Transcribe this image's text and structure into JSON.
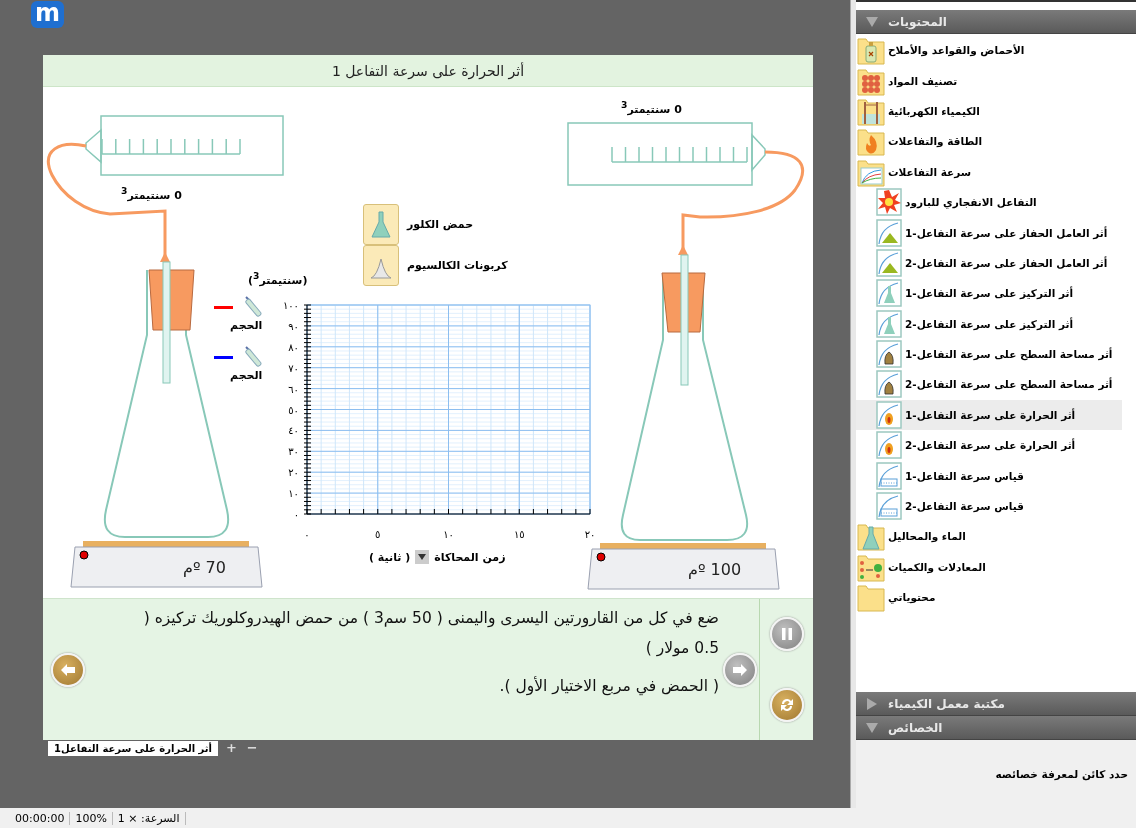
{
  "logo": "m",
  "simulation": {
    "title": "أثر الحرارة على سرعة  التفاعل 1",
    "left_setup": {
      "syringe_reading": "0 سنتيمتر$^{3}$",
      "temperature": "70 ºم"
    },
    "right_setup": {
      "syringe_reading": "0 سنتيمتر$^{3}$",
      "temperature": "100 ºم"
    },
    "reagents": [
      {
        "label": "حمض الكلور",
        "kind": "flask"
      },
      {
        "label": "كربونات الكالسيوم",
        "kind": "powder"
      }
    ],
    "legend": [
      {
        "label": "الحجم",
        "color": "#ff0000"
      },
      {
        "label": "الحجم",
        "color": "#0000ff"
      }
    ],
    "chart_data": {
      "type": "line",
      "grid": true,
      "xlabel": "زمن المحاكاة",
      "ylabel": "(سنتيمتر$^{3}$)",
      "xlim": [
        0,
        20
      ],
      "ylim": [
        0,
        100
      ],
      "xticks": [
        {
          "value": 0,
          "label": "٠"
        },
        {
          "value": 5,
          "label": "٥"
        },
        {
          "value": 10,
          "label": "١٠"
        },
        {
          "value": 15,
          "label": "١٥"
        },
        {
          "value": 20,
          "label": "٢٠"
        }
      ],
      "yticks": [
        {
          "value": 0,
          "label": "٠"
        },
        {
          "value": 10,
          "label": "١٠"
        },
        {
          "value": 20,
          "label": "٢٠"
        },
        {
          "value": 30,
          "label": "٣٠"
        },
        {
          "value": 40,
          "label": "٤٠"
        },
        {
          "value": 50,
          "label": "٥٠"
        },
        {
          "value": 60,
          "label": "٦٠"
        },
        {
          "value": 70,
          "label": "٧٠"
        },
        {
          "value": 80,
          "label": "٨٠"
        },
        {
          "value": 90,
          "label": "٩٠"
        },
        {
          "value": 100,
          "label": "١٠٠"
        }
      ]
    },
    "time_unit": "( ثانية )",
    "instructions": [
      "ضع في كل من القارورتين اليسرى واليمنى ( 50 سم3 ) من حمض الهيدروكلوريك تركيزه ( 0.5 مولار )",
      "( الحمض في مربع الاختيار الأول )."
    ]
  },
  "tabs": [
    {
      "label": "أثر الحرارة على سرعة التفاعل1",
      "selected": true
    }
  ],
  "tab_controls": [
    "−",
    "+"
  ],
  "status_bar": [
    "السرعة: × 1",
    "100%",
    "00:00:00"
  ],
  "sidebar": {
    "panels": [
      {
        "title": "المحتويات",
        "expanded": true,
        "tree": [
          {
            "label": "الأحماض والقواعد والأملاح",
            "kind": "bottle",
            "selected": false
          },
          {
            "label": "تصنيف المواد",
            "kind": "spheres",
            "selected": false
          },
          {
            "label": "الكيمياء الكهربائية",
            "kind": "cell",
            "selected": false
          },
          {
            "label": "الطاقة والتفاعلات",
            "kind": "flame",
            "selected": false
          },
          {
            "label": "سرعة التفاعلات",
            "kind": "curves",
            "selected": false,
            "children": [
              {
                "label": "التفاعل الانفجاري للبارود",
                "kind": "burst",
                "selected": false
              },
              {
                "label": "أثر العامل الحفاز على سرعة التفاعل-1",
                "kind": "cone",
                "selected": false
              },
              {
                "label": "أثر العامل الحفاز على سرعة التفاعل-2",
                "kind": "cone",
                "selected": false
              },
              {
                "label": "أثر التركيز على سرعة التفاعل-1",
                "kind": "flask",
                "selected": false
              },
              {
                "label": "أثر التركيز على سرعة التفاعل-2",
                "kind": "flask",
                "selected": false
              },
              {
                "label": "أثر مساحة السطح على سرعة التفاعل-1",
                "kind": "lump",
                "selected": false
              },
              {
                "label": "أثر مساحة السطح على سرعة التفاعل-2",
                "kind": "lump",
                "selected": false
              },
              {
                "label": "أثر الحرارة على سرعة التفاعل-1",
                "kind": "flame",
                "selected": true
              },
              {
                "label": "أثر الحرارة على سرعة التفاعل-2",
                "kind": "flame",
                "selected": false
              },
              {
                "label": "قياس سرعة التفاعل-1",
                "kind": "beaker",
                "selected": false
              },
              {
                "label": "قياس سرعة التفاعل-2",
                "kind": "beaker",
                "selected": false
              }
            ]
          },
          {
            "label": "الماء والمحاليل",
            "kind": "flask",
            "selected": false
          },
          {
            "label": "المعادلات والكميات",
            "kind": "nodes",
            "selected": false
          },
          {
            "label": "محتوياتي",
            "kind": "plain",
            "selected": false
          }
        ]
      },
      {
        "title": "مكتبة معمل الكيمياء",
        "expanded": false
      },
      {
        "title": "الخصائص",
        "expanded": true,
        "message": "حدد كائن لمعرفة خصائصه"
      }
    ]
  }
}
